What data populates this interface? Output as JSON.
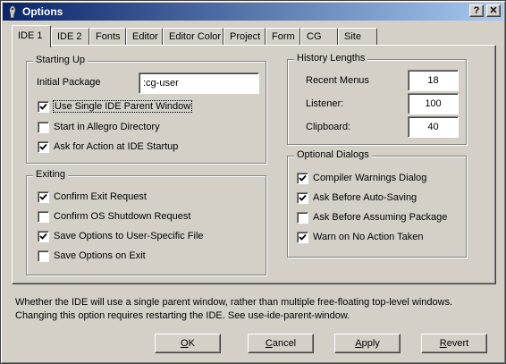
{
  "window": {
    "title": "Options",
    "help_button": "?",
    "close_button": "✕"
  },
  "tabs": [
    {
      "label": "IDE 1",
      "active": true
    },
    {
      "label": "IDE 2"
    },
    {
      "label": "Fonts"
    },
    {
      "label": "Editor"
    },
    {
      "label": "Editor Color"
    },
    {
      "label": "Project"
    },
    {
      "label": "Form"
    },
    {
      "label": "CG"
    },
    {
      "label": "Site"
    }
  ],
  "starting_up": {
    "title": "Starting Up",
    "initial_package_label": "Initial Package",
    "initial_package_value": ":cg-user",
    "options": [
      {
        "label": "Use Single IDE Parent Window",
        "checked": true
      },
      {
        "label": "Start in Allegro Directory",
        "checked": false
      },
      {
        "label": "Ask for Action at IDE Startup",
        "checked": true
      }
    ]
  },
  "exiting": {
    "title": "Exiting",
    "options": [
      {
        "label": "Confirm Exit Request",
        "checked": true
      },
      {
        "label": "Confirm OS Shutdown Request",
        "checked": false
      },
      {
        "label": "Save Options to User-Specific File",
        "checked": true
      },
      {
        "label": "Save Options on Exit",
        "checked": false
      }
    ]
  },
  "history": {
    "title": "History Lengths",
    "recent_menus_label": "Recent Menus",
    "recent_menus_value": "18",
    "listener_label": "Listener:",
    "listener_value": "100",
    "clipboard_label": "Clipboard:",
    "clipboard_value": "40"
  },
  "optional_dialogs": {
    "title": "Optional Dialogs",
    "options": [
      {
        "label": "Compiler Warnings Dialog",
        "checked": true
      },
      {
        "label": "Ask Before Auto-Saving",
        "checked": true
      },
      {
        "label": "Ask Before Assuming Package",
        "checked": false
      },
      {
        "label": "Warn on No Action Taken",
        "checked": true
      }
    ]
  },
  "description": {
    "line1": "Whether the IDE will use a single parent window, rather than multiple free-floating top-level windows.",
    "line2": "Changing this option requires restarting the IDE.  See use-ide-parent-window."
  },
  "buttons": {
    "ok": {
      "first": "O",
      "rest": "K"
    },
    "cancel": {
      "first": "C",
      "rest": "ancel"
    },
    "apply": {
      "first": "A",
      "rest": "pply"
    },
    "revert": {
      "first": "R",
      "rest": "evert"
    }
  }
}
